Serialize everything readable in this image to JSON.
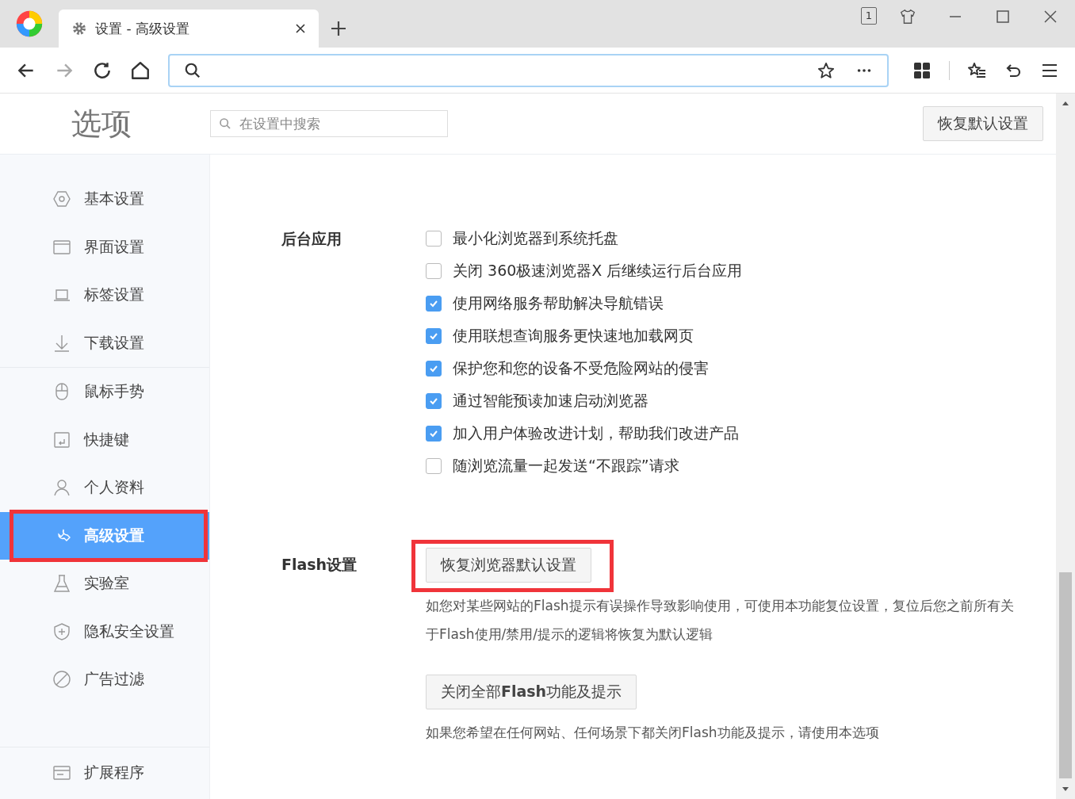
{
  "browser": {
    "tab": {
      "title": "设置 - 高级设置"
    },
    "window_count": "1"
  },
  "header": {
    "title": "选项",
    "search": {
      "placeholder": "在设置中搜索"
    },
    "reset_button": "恢复默认设置"
  },
  "sidebar": {
    "sections": [
      [
        {
          "label": "基本设置",
          "selected": false,
          "highlighted": false
        },
        {
          "label": "界面设置",
          "selected": false,
          "highlighted": false
        },
        {
          "label": "标签设置",
          "selected": false,
          "highlighted": false
        },
        {
          "label": "下载设置",
          "selected": false,
          "highlighted": false
        }
      ],
      [
        {
          "label": "鼠标手势",
          "selected": false,
          "highlighted": false
        },
        {
          "label": "快捷键",
          "selected": false,
          "highlighted": false
        },
        {
          "label": "个人资料",
          "selected": false,
          "highlighted": false
        },
        {
          "label": "高级设置",
          "selected": true,
          "highlighted": true
        },
        {
          "label": "实验室",
          "selected": false,
          "highlighted": false
        },
        {
          "label": "隐私安全设置",
          "selected": false,
          "highlighted": false
        },
        {
          "label": "广告过滤",
          "selected": false,
          "highlighted": false
        }
      ],
      [
        {
          "label": "扩展程序",
          "selected": false,
          "highlighted": false
        }
      ]
    ]
  },
  "sections": [
    {
      "title": "后台应用",
      "options": [
        {
          "label": "最小化浏览器到系统托盘",
          "checked": false
        },
        {
          "label": "关闭 360极速浏览器X 后继续运行后台应用",
          "checked": false
        },
        {
          "label": "使用网络服务帮助解决导航错误",
          "checked": true
        },
        {
          "label": "使用联想查询服务更快速地加载网页",
          "checked": true
        },
        {
          "label": "保护您和您的设备不受危险网站的侵害",
          "checked": true
        },
        {
          "label": "通过智能预读加速启动浏览器",
          "checked": true
        },
        {
          "label": "加入用户体验改进计划，帮助我们改进产品",
          "checked": true
        },
        {
          "label": "随浏览流量一起发送“不跟踪”请求",
          "checked": false
        }
      ]
    },
    {
      "title": "Flash设置",
      "actions": [
        {
          "button": "恢复浏览器默认设置",
          "highlighted": true,
          "description": "如您对某些网站的Flash提示有误操作导致影响使用，可使用本功能复位设置，复位后您之前所有关于Flash使用/禁用/提示的逻辑将恢复为默认逻辑"
        },
        {
          "button": "关闭全部**Flash**功能及提示",
          "highlighted": false,
          "description": "如果您希望在任何网站、任何场景下都关闭Flash功能及提示，请使用本选项"
        }
      ]
    }
  ]
}
